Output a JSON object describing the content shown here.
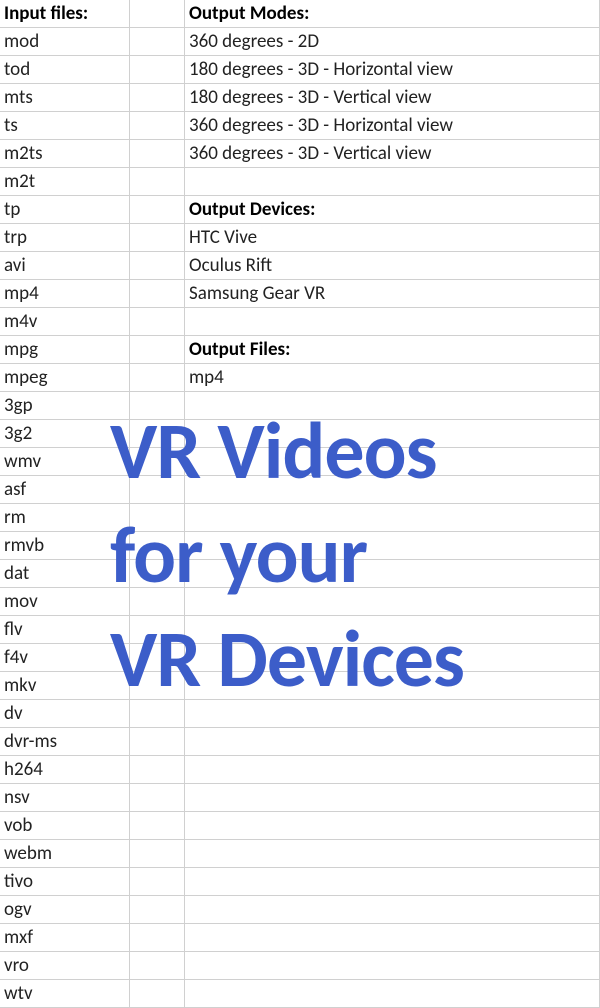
{
  "headers": {
    "input_files": "Input files:",
    "output_modes": "Output Modes:",
    "output_devices": "Output Devices:",
    "output_files": "Output Files:"
  },
  "input_files": [
    "mod",
    " tod",
    " mts",
    " ts",
    " m2ts",
    "m2t",
    " tp",
    "trp",
    "avi",
    "mp4",
    "m4v",
    "mpg",
    "mpeg",
    "3gp",
    "3g2",
    "wmv",
    "asf",
    "rm",
    "rmvb",
    "dat",
    "mov",
    "flv",
    "f4v",
    "mkv",
    "dv",
    "dvr-ms",
    "h264",
    "nsv",
    "vob",
    "webm",
    "tivo",
    "ogv",
    "mxf",
    "vro",
    "wtv"
  ],
  "output_modes": [
    "360 degrees - 2D",
    "180 degrees - 3D - Horizontal view",
    "180 degrees - 3D - Vertical view",
    "360 degrees - 3D - Horizontal view",
    "360 degrees - 3D - Vertical view"
  ],
  "output_devices": [
    "HTC Vive",
    "Oculus Rift",
    "Samsung Gear VR"
  ],
  "output_files": [
    "mp4"
  ],
  "overlay": {
    "line1": "VR Videos",
    "line2": "for your",
    "line3": "VR Devices"
  },
  "indented_input_rows": [
    1,
    2,
    3,
    4,
    6
  ]
}
